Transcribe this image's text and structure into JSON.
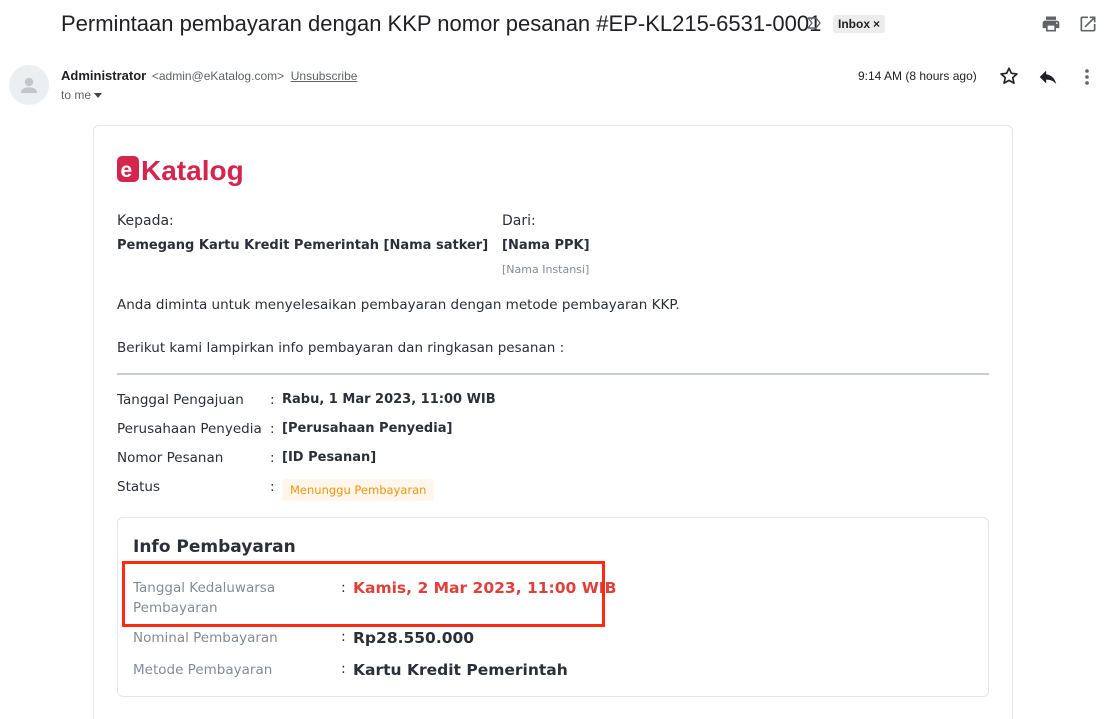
{
  "email": {
    "subject": "Permintaan pembayaran dengan KKP nomor pesanan #EP-KL215-6531-0001",
    "label": "Inbox",
    "label_close": "×",
    "sender_name": "Administrator",
    "sender_email": "<admin@eKatalog.com>",
    "unsubscribe": "Unsubscribe",
    "to": "to me",
    "timestamp": "9:14 AM (8 hours ago)"
  },
  "content": {
    "logo_text": "eKatalog",
    "brand_color": "#d6254d",
    "kepada_label": "Kepada:",
    "kepada_value": "Pemegang Kartu Kredit Pemerintah [Nama satker]",
    "dari_label": "Dari:",
    "dari_value": "[Nama PPK]",
    "dari_instansi": "[Nama Instansi]",
    "paragraph1": "Anda diminta untuk menyelesaikan pembayaran dengan metode pembayaran KKP.",
    "paragraph2": "Berikut kami lampirkan info pembayaran dan ringkasan pesanan :",
    "details": [
      {
        "label": "Tanggal Pengajuan",
        "value": "Rabu, 1 Mar 2023, 11:00 WIB"
      },
      {
        "label": "Perusahaan Penyedia",
        "value": "[Perusahaan Penyedia]"
      },
      {
        "label": "Nomor Pesanan",
        "value": "[ID Pesanan]"
      },
      {
        "label": "Status",
        "value": "Menunggu Pembayaran"
      }
    ],
    "info": {
      "title": "Info Pembayaran",
      "rows": [
        {
          "label_line1": "Tanggal Kedaluwarsa",
          "label_line2": "Pembayaran",
          "value": "Kamis, 2 Mar 2023, 11:00 WIB"
        },
        {
          "label_line1": "Nominal Pembayaran",
          "value": "Rp28.550.000"
        },
        {
          "label_line1": "Metode Pembayaran",
          "value": "Kartu Kredit Pemerintah"
        }
      ]
    },
    "colon": ":"
  },
  "icons": {
    "important": "important-marker-icon",
    "print": "print-icon",
    "popout": "open-in-new-window-icon",
    "avatar": "person-avatar-icon",
    "star": "star-icon",
    "reply": "reply-icon",
    "more": "more-vertical-icon"
  },
  "colors": {
    "status_text": "#f2950a",
    "status_bg": "#fff7ec",
    "expiry_text": "#e0403a",
    "highlight": "#ff2a10"
  }
}
